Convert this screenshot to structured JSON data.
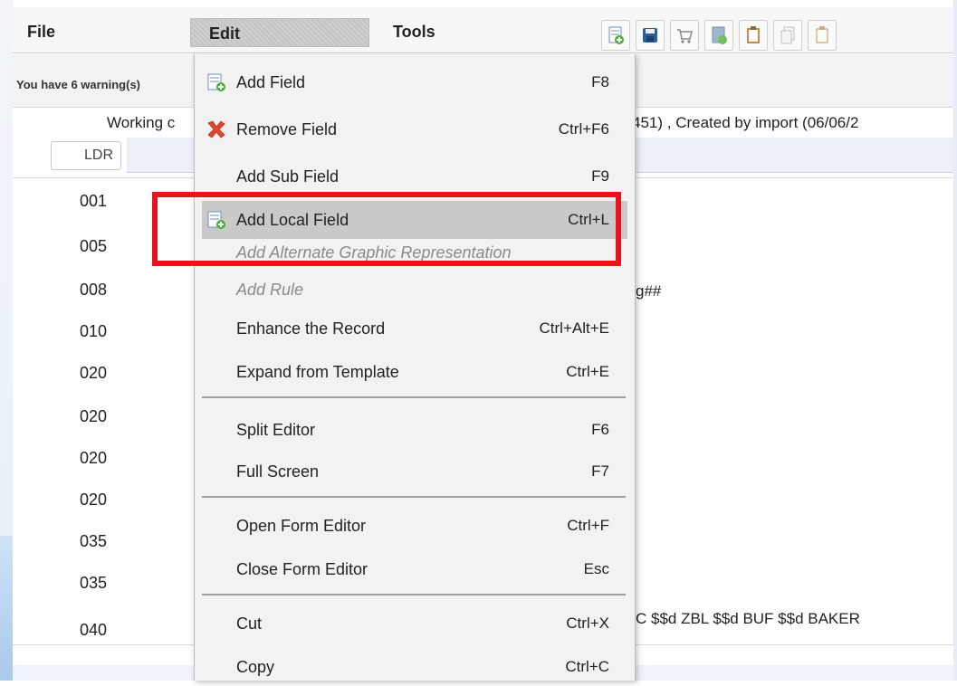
{
  "menubar": {
    "file": "File",
    "edit": "Edit",
    "tools": "Tools"
  },
  "toolbar": {
    "icons": [
      "new-record-icon",
      "save-icon",
      "cart-icon",
      "record-icon",
      "clipboard-icon",
      "copy-icon",
      "paste-icon"
    ]
  },
  "warnings": "You have 6 warning(s)",
  "record": {
    "working_left": "Working c",
    "working_right": "451) , Created by import (06/06/2",
    "ldr": "LDR",
    "tags": [
      "001",
      "005",
      "008",
      "010",
      "020",
      "020",
      "020",
      "020",
      "035",
      "035",
      "040"
    ],
    "row_008_tail": "g##",
    "row_040_tail": "C $$d ZBL $$d BUF $$d BAKER"
  },
  "menu": {
    "items": [
      {
        "label": "Add Field",
        "shortcut": "F8",
        "icon": "add-field-icon"
      },
      {
        "label": "Remove Field",
        "shortcut": "Ctrl+F6",
        "icon": "remove-field-icon"
      },
      {
        "label": "Add Sub Field",
        "shortcut": "F9"
      },
      {
        "label": "Add Local Field",
        "shortcut": "Ctrl+L",
        "icon": "add-local-field-icon"
      },
      {
        "label": "Add Alternate Graphic Representation",
        "shortcut": ""
      },
      {
        "label": "Add Rule",
        "shortcut": ""
      },
      {
        "label": "Enhance the Record",
        "shortcut": "Ctrl+Alt+E"
      },
      {
        "label": "Expand from Template",
        "shortcut": "Ctrl+E"
      },
      {
        "label": "Split Editor",
        "shortcut": "F6"
      },
      {
        "label": "Full Screen",
        "shortcut": "F7"
      },
      {
        "label": "Open Form Editor",
        "shortcut": "Ctrl+F"
      },
      {
        "label": "Close Form Editor",
        "shortcut": "Esc"
      },
      {
        "label": "Cut",
        "shortcut": "Ctrl+X"
      },
      {
        "label": "Copy",
        "shortcut": "Ctrl+C"
      }
    ]
  },
  "colors": {
    "highlight_box": "#e8141c",
    "menu_bg": "#f2f2f2",
    "hover_bg": "#c9c9c9"
  }
}
